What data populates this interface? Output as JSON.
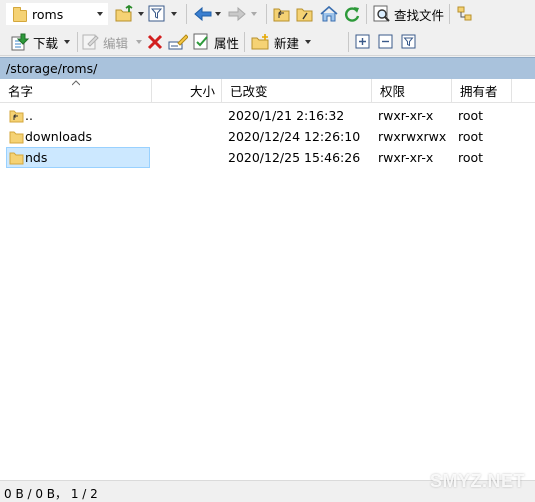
{
  "toolbar1": {
    "path_combo": "roms",
    "find_files_label": "查找文件"
  },
  "toolbar2": {
    "download_label": "下载",
    "edit_label": "编辑",
    "properties_label": "属性",
    "new_label": "新建"
  },
  "path": "/storage/roms/",
  "columns": {
    "name": "名字",
    "size": "大小",
    "modified": "已改变",
    "permissions": "权限",
    "owner": "拥有者"
  },
  "files": [
    {
      "name": "..",
      "size": "",
      "modified": "2020/1/21 2:16:32",
      "permissions": "rwxr-xr-x",
      "owner": "root",
      "icon": "parent-folder-icon",
      "selected": false
    },
    {
      "name": "downloads",
      "size": "",
      "modified": "2020/12/24 12:26:10",
      "permissions": "rwxrwxrwx",
      "owner": "root",
      "icon": "folder-icon",
      "selected": false
    },
    {
      "name": "nds",
      "size": "",
      "modified": "2020/12/25 15:46:26",
      "permissions": "rwxr-xr-x",
      "owner": "root",
      "icon": "folder-icon",
      "selected": true
    }
  ],
  "status": "0 B / 0 B，  1 / 2",
  "watermark": "SMYZ.NET",
  "colors": {
    "path_bar": "#a9c2dc",
    "selection": "#cce8ff",
    "folder": "#f5d274"
  }
}
